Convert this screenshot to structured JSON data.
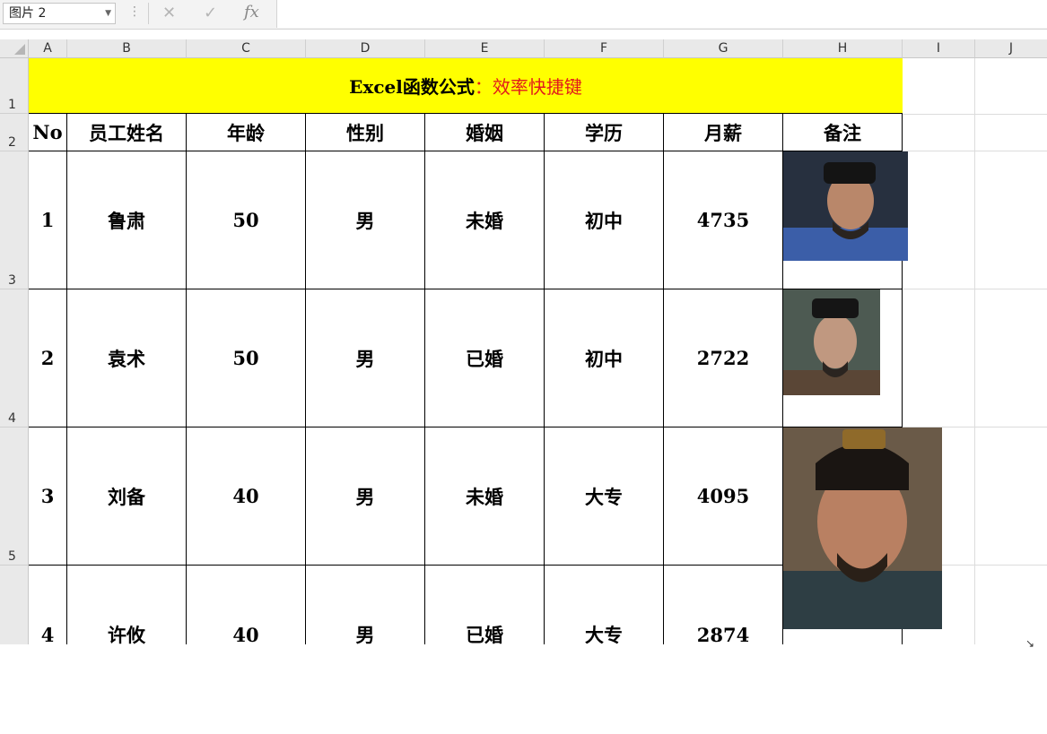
{
  "name_box": "图片 2",
  "columns": [
    "A",
    "B",
    "C",
    "D",
    "E",
    "F",
    "G",
    "H",
    "I",
    "J"
  ],
  "rows": [
    "1",
    "2",
    "3",
    "4",
    "5"
  ],
  "title": {
    "part1": "Excel函数公式",
    "part2": "：效率快捷键"
  },
  "headers": [
    "No",
    "员工姓名",
    "年龄",
    "性别",
    "婚姻",
    "学历",
    "月薪",
    "备注"
  ],
  "records": [
    {
      "no": "1",
      "name": "鲁肃",
      "age": "50",
      "gender": "男",
      "marriage": "未婚",
      "education": "初中",
      "salary": "4735"
    },
    {
      "no": "2",
      "name": "袁术",
      "age": "50",
      "gender": "男",
      "marriage": "已婚",
      "education": "初中",
      "salary": "2722"
    },
    {
      "no": "3",
      "name": "刘备",
      "age": "40",
      "gender": "男",
      "marriage": "未婚",
      "education": "大专",
      "salary": "4095"
    },
    {
      "no": "4",
      "name": "许攸",
      "age": "40",
      "gender": "男",
      "marriage": "已婚",
      "education": "大专",
      "salary": "2874"
    }
  ],
  "colors": {
    "title_bg": "#ffff00",
    "title_accent": "#e21b1b"
  }
}
